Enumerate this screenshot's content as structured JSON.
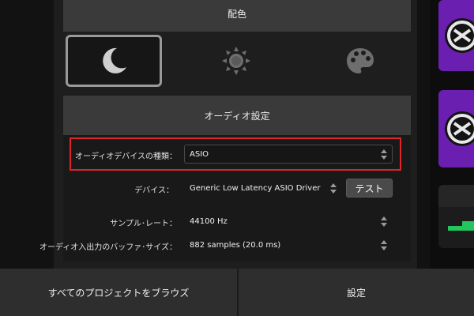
{
  "color_section": {
    "header": "配色",
    "themes": [
      {
        "name": "moon-icon",
        "selected": true
      },
      {
        "name": "sun-icon",
        "selected": false
      },
      {
        "name": "palette-icon",
        "selected": false
      }
    ]
  },
  "audio_section": {
    "header": "オーディオ設定",
    "device_type": {
      "label": "オーディオデバイスの種類：",
      "value": "ASIO"
    },
    "device": {
      "label": "デバイス：",
      "value": "Generic Low Latency ASIO Driver"
    },
    "test_button": "テスト",
    "sample_rate": {
      "label": "サンプル･レート：",
      "value": "44100 Hz"
    },
    "buffer_size": {
      "label": "オーディオ入出力のバッファ･サイズ：",
      "value": "882 samples (20.0 ms)"
    }
  },
  "footer": {
    "browse_label": "すべてのプロジェクトをブラウズ",
    "settings_label": "設定"
  },
  "colors": {
    "highlight": "#e0242c",
    "thumb_purple": "#6a1fb0",
    "thumb_green": "#22c55e"
  }
}
